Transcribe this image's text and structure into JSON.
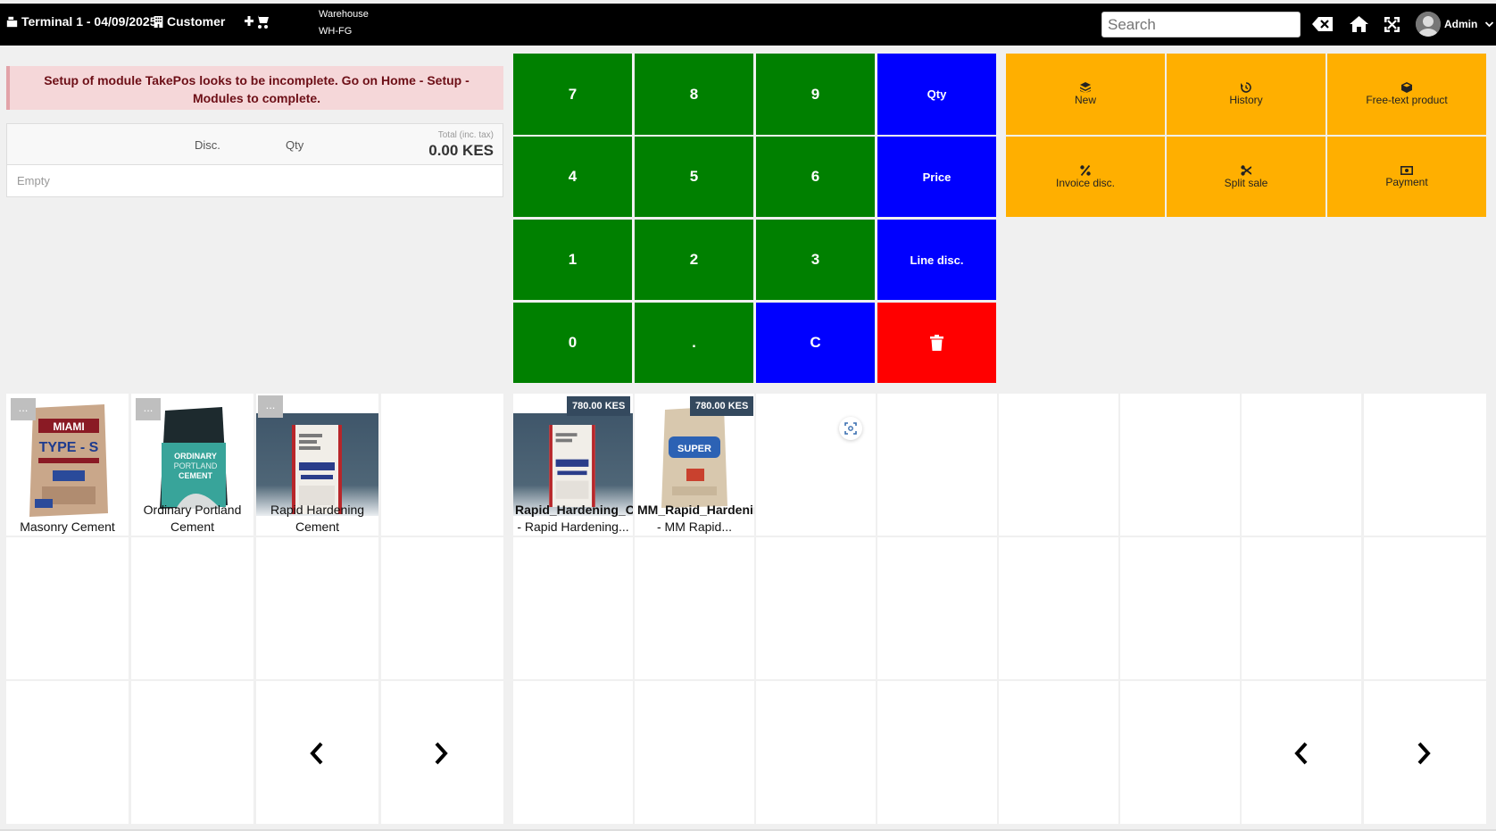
{
  "header": {
    "terminal_label": "Terminal 1 - 04/09/2025",
    "customer_label": "Customer",
    "warehouse_label": "Warehouse",
    "warehouse_value": "WH-FG",
    "search_placeholder": "Search",
    "user_label": "Admin"
  },
  "alert": {
    "message": "Setup of module TakePos looks to be incomplete. Go on Home - Setup - Modules to complete."
  },
  "order": {
    "disc_header": "Disc.",
    "qty_header": "Qty",
    "total_label": "Total (inc. tax)",
    "total_value": "0.00 KES",
    "empty_text": "Empty"
  },
  "keypad": {
    "k7": "7",
    "k8": "8",
    "k9": "9",
    "qty": "Qty",
    "k4": "4",
    "k5": "5",
    "k6": "6",
    "price": "Price",
    "k1": "1",
    "k2": "2",
    "k3": "3",
    "line_disc": "Line disc.",
    "k0": "0",
    "dot": ".",
    "clear": "C"
  },
  "actions": {
    "new": "New",
    "history": "History",
    "free_text": "Free-text product",
    "invoice_disc": "Invoice disc.",
    "split_sale": "Split sale",
    "payment": "Payment"
  },
  "categories": [
    {
      "label": "Masonry Cement",
      "more": "..."
    },
    {
      "label": "Ordinary Portland Cement",
      "more": "..."
    },
    {
      "label": "Rapid Hardening Cement",
      "more": "..."
    }
  ],
  "products": [
    {
      "ref": "Rapid_Hardening_Cement",
      "name": "- Rapid Hardening...",
      "price": "780.00 KES"
    },
    {
      "ref": "MM_Rapid_Hardening",
      "name": "- MM Rapid...",
      "price": "780.00 KES"
    }
  ],
  "colors": {
    "topbar": "#000000",
    "key_green": "#008000",
    "key_blue": "#0000ff",
    "key_red": "#ff0000",
    "action_orange": "#ffaf00",
    "alert_bg": "#f5d7d9",
    "alert_text": "#6d0f17",
    "price_badge": "#34495e"
  },
  "icons": [
    "cash-register-icon",
    "building-icon",
    "add-cart-icon",
    "backspace-icon",
    "home-icon",
    "fullscreen-icon",
    "user-avatar-icon",
    "chevron-down-icon",
    "layers-icon",
    "history-icon",
    "cube-icon",
    "percent-icon",
    "scissors-icon",
    "money-bill-icon",
    "trash-icon",
    "scan-icon",
    "chevron-left-icon",
    "chevron-right-icon"
  ]
}
